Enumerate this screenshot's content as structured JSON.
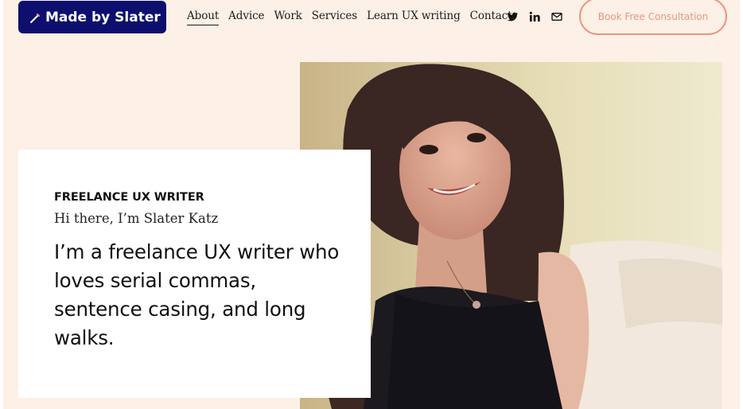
{
  "brand": {
    "name": "Made by Slater",
    "icon": "pen-icon"
  },
  "nav": {
    "items": [
      {
        "label": "About",
        "active": true
      },
      {
        "label": "Advice"
      },
      {
        "label": "Work"
      },
      {
        "label": "Services"
      },
      {
        "label": "Learn UX writing"
      },
      {
        "label": "Contact"
      }
    ]
  },
  "socials": [
    "twitter-icon",
    "linkedin-icon",
    "mail-icon"
  ],
  "cta": {
    "label": "Book Free Consultation",
    "color": "#e9967d"
  },
  "hero": {
    "eyebrow": "FREELANCE UX WRITER",
    "greeting": "Hi there, I’m Slater Katz",
    "headline": "I’m a freelance UX writer who loves serial commas, sentence casing, and long walks."
  },
  "colors": {
    "background": "#fdf0e6",
    "brand": "#0d0f6e",
    "accent": "#e9967d"
  }
}
